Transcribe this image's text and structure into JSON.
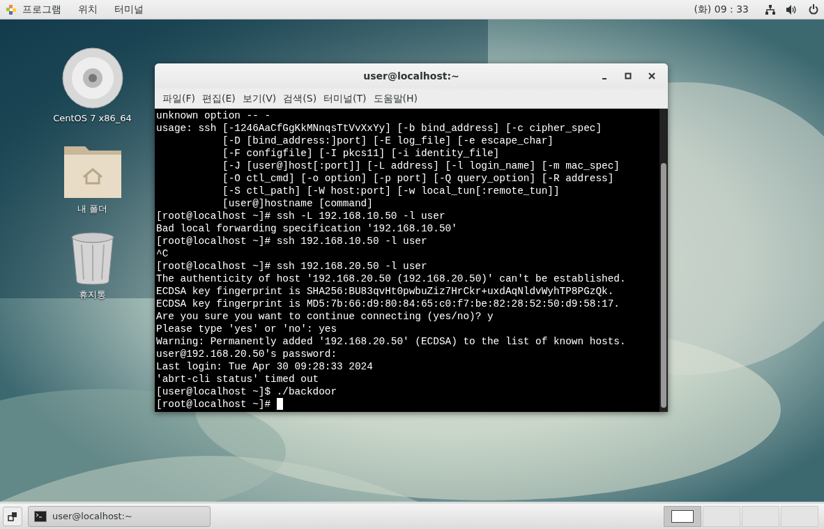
{
  "top_bar": {
    "menus": [
      "프로그램",
      "위치",
      "터미널"
    ],
    "clock": "(화) 09 : 33"
  },
  "desktop_icons": [
    {
      "kind": "disc",
      "label": "CentOS 7 x86_64"
    },
    {
      "kind": "folder",
      "label": "내 폴더"
    },
    {
      "kind": "trash",
      "label": "휴지통"
    }
  ],
  "terminal": {
    "title": "user@localhost:~",
    "menu": [
      "파일(F)",
      "편집(E)",
      "보기(V)",
      "검색(S)",
      "터미널(T)",
      "도움말(H)"
    ],
    "lines": [
      "unknown option -- -",
      "usage: ssh [-1246AaCfGgKkMNnqsTtVvXxYy] [-b bind_address] [-c cipher_spec]",
      "           [-D [bind_address:]port] [-E log_file] [-e escape_char]",
      "           [-F configfile] [-I pkcs11] [-i identity_file]",
      "           [-J [user@]host[:port]] [-L address] [-l login_name] [-m mac_spec]",
      "           [-O ctl_cmd] [-o option] [-p port] [-Q query_option] [-R address]",
      "           [-S ctl_path] [-W host:port] [-w local_tun[:remote_tun]]",
      "           [user@]hostname [command]",
      "[root@localhost ~]# ssh -L 192.168.10.50 -l user",
      "Bad local forwarding specification '192.168.10.50'",
      "[root@localhost ~]# ssh 192.168.10.50 -l user",
      "^C",
      "[root@localhost ~]# ssh 192.168.20.50 -l user",
      "The authenticity of host '192.168.20.50 (192.168.20.50)' can't be established.",
      "ECDSA key fingerprint is SHA256:BU83qvHt0pwbuZiz7HrCkr+uxdAqNldvWyhTP8PGzQk.",
      "ECDSA key fingerprint is MD5:7b:66:d9:80:84:65:c0:f7:be:82:28:52:50:d9:58:17.",
      "Are you sure you want to continue connecting (yes/no)? y",
      "Please type 'yes' or 'no': yes",
      "Warning: Permanently added '192.168.20.50' (ECDSA) to the list of known hosts.",
      "user@192.168.20.50's password:",
      "Last login: Tue Apr 30 09:28:33 2024",
      "'abrt-cli status' timed out",
      "[user@localhost ~]$ ./backdoor",
      "[root@localhost ~]#"
    ]
  },
  "taskbar": {
    "windows": [
      {
        "label": "user@localhost:~",
        "selected": false
      }
    ],
    "workspaces": [
      {
        "selected": true
      },
      {
        "selected": false
      },
      {
        "selected": false
      },
      {
        "selected": false
      }
    ]
  }
}
